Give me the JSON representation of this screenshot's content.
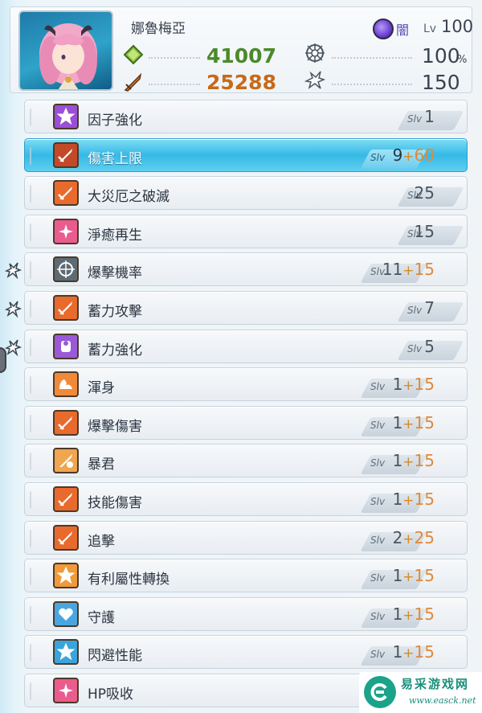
{
  "character": {
    "name": "娜魯梅亞",
    "attribute": "闇",
    "level_label": "Lv",
    "level": "100",
    "hp": "41007",
    "atk": "25288",
    "crit_rate": "100",
    "crit_unit": "%",
    "second_stat": "150"
  },
  "skills": [
    {
      "name": "因子強化",
      "slv_label": "Slv",
      "base": "1",
      "plus": "",
      "bonus": "",
      "icon": "star-icon",
      "icon_color": "#9b4fd6",
      "selected": false,
      "chain": false
    },
    {
      "name": "傷害上限",
      "slv_label": "Slv",
      "base": "9",
      "plus": "+",
      "bonus": "60",
      "icon": "sword-icon",
      "icon_color": "#c24a28",
      "selected": true,
      "chain": false
    },
    {
      "name": "大災厄之破滅",
      "slv_label": "Slv",
      "base": "25",
      "plus": "",
      "bonus": "",
      "icon": "sword-icon",
      "icon_color": "#e86a2c",
      "selected": false,
      "chain": false
    },
    {
      "name": "淨癒再生",
      "slv_label": "Slv",
      "base": "15",
      "plus": "",
      "bonus": "",
      "icon": "sparkle-icon",
      "icon_color": "#ea5c8e",
      "selected": false,
      "chain": false
    },
    {
      "name": "爆擊機率",
      "slv_label": "Slv",
      "base": "11",
      "plus": "+",
      "bonus": "15",
      "icon": "crit-icon",
      "icon_color": "#5d6b74",
      "selected": false,
      "chain": true
    },
    {
      "name": "蓄力攻擊",
      "slv_label": "Slv",
      "base": "7",
      "plus": "",
      "bonus": "",
      "icon": "sword-icon",
      "icon_color": "#e86a2c",
      "selected": false,
      "chain": true
    },
    {
      "name": "蓄力強化",
      "slv_label": "Slv",
      "base": "5",
      "plus": "",
      "bonus": "",
      "icon": "armor-icon",
      "icon_color": "#9a5ad8",
      "selected": false,
      "chain": true
    },
    {
      "name": "渾身",
      "slv_label": "Slv",
      "base": "1",
      "plus": "+",
      "bonus": "15",
      "icon": "muscle-icon",
      "icon_color": "#f08a3a",
      "selected": false,
      "chain": false
    },
    {
      "name": "爆擊傷害",
      "slv_label": "Slv",
      "base": "1",
      "plus": "+",
      "bonus": "15",
      "icon": "sword-icon",
      "icon_color": "#e86a2c",
      "selected": false,
      "chain": false
    },
    {
      "name": "暴君",
      "slv_label": "Slv",
      "base": "1",
      "plus": "+",
      "bonus": "15",
      "icon": "tyrant-icon",
      "icon_color": "#f0a550",
      "selected": false,
      "chain": false
    },
    {
      "name": "技能傷害",
      "slv_label": "Slv",
      "base": "1",
      "plus": "+",
      "bonus": "15",
      "icon": "sword-icon",
      "icon_color": "#e86a2c",
      "selected": false,
      "chain": false
    },
    {
      "name": "追擊",
      "slv_label": "Slv",
      "base": "2",
      "plus": "+",
      "bonus": "25",
      "icon": "sword-icon",
      "icon_color": "#e86a2c",
      "selected": false,
      "chain": false
    },
    {
      "name": "有利屬性轉換",
      "slv_label": "Slv",
      "base": "1",
      "plus": "+",
      "bonus": "15",
      "icon": "star-icon",
      "icon_color": "#f09a3a",
      "selected": false,
      "chain": false
    },
    {
      "name": "守護",
      "slv_label": "Slv",
      "base": "1",
      "plus": "+",
      "bonus": "15",
      "icon": "heart-icon",
      "icon_color": "#4aa6e0",
      "selected": false,
      "chain": false
    },
    {
      "name": "閃避性能",
      "slv_label": "Slv",
      "base": "1",
      "plus": "+",
      "bonus": "15",
      "icon": "star-icon",
      "icon_color": "#3aa4dc",
      "selected": false,
      "chain": false
    },
    {
      "name": "HP吸收",
      "slv_label": "S",
      "base": "",
      "plus": "",
      "bonus": "",
      "icon": "sparkle-icon",
      "icon_color": "#ea5c8e",
      "selected": false,
      "chain": false
    }
  ],
  "watermark": {
    "title": "易采游戏网",
    "url": "www.easck.net"
  }
}
